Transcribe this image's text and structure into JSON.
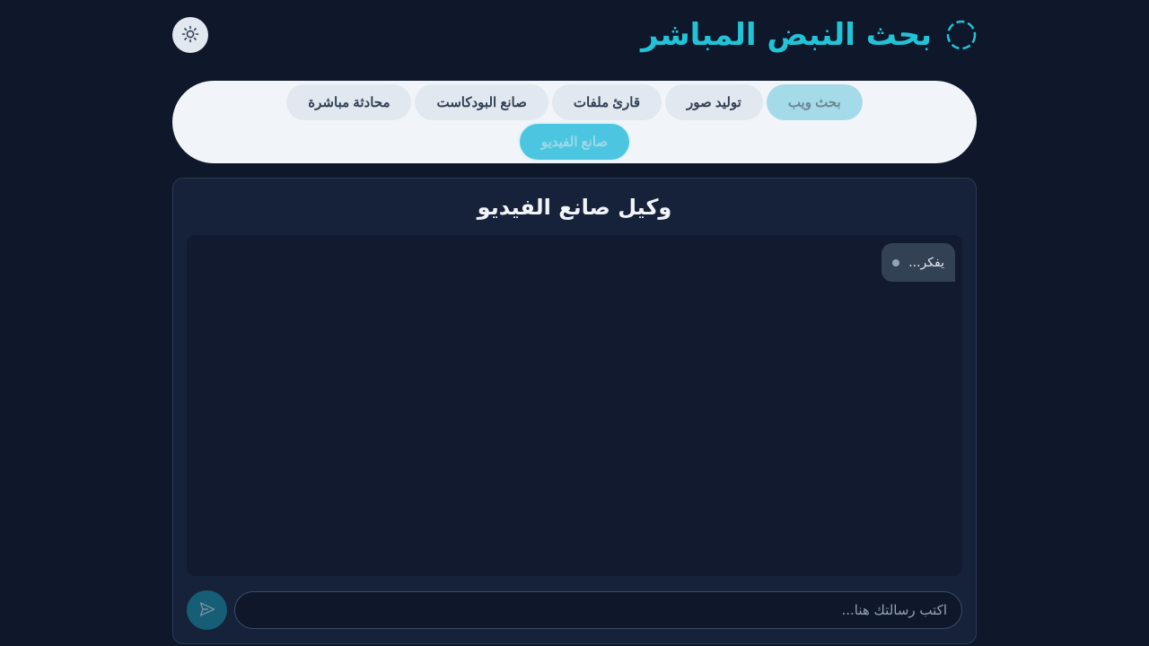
{
  "header": {
    "title": "بحث النبض المباشر",
    "brand_icon": "pulse-circle-icon",
    "theme_toggle_icon": "sun-icon"
  },
  "tabs": [
    {
      "label": "بحث ويب",
      "state": "dimmed"
    },
    {
      "label": "توليد صور",
      "state": "normal"
    },
    {
      "label": "قارئ ملفات",
      "state": "normal"
    },
    {
      "label": "صانع البودكاست",
      "state": "normal"
    },
    {
      "label": "محادثة مباشرة",
      "state": "normal"
    },
    {
      "label": "صانع الفيديو",
      "state": "active"
    }
  ],
  "panel": {
    "title": "وكيل صانع الفيديو",
    "messages": [
      {
        "text": "يفكر...",
        "role": "assistant",
        "status": "thinking"
      }
    ],
    "input": {
      "value": "",
      "placeholder": "اكتب رسالتك هنا..."
    },
    "send_icon": "send-icon"
  },
  "colors": {
    "background": "#0f172a",
    "accent": "#22c3d6",
    "panel": "#16213a",
    "tabs_bar": "#f1f5f9"
  }
}
